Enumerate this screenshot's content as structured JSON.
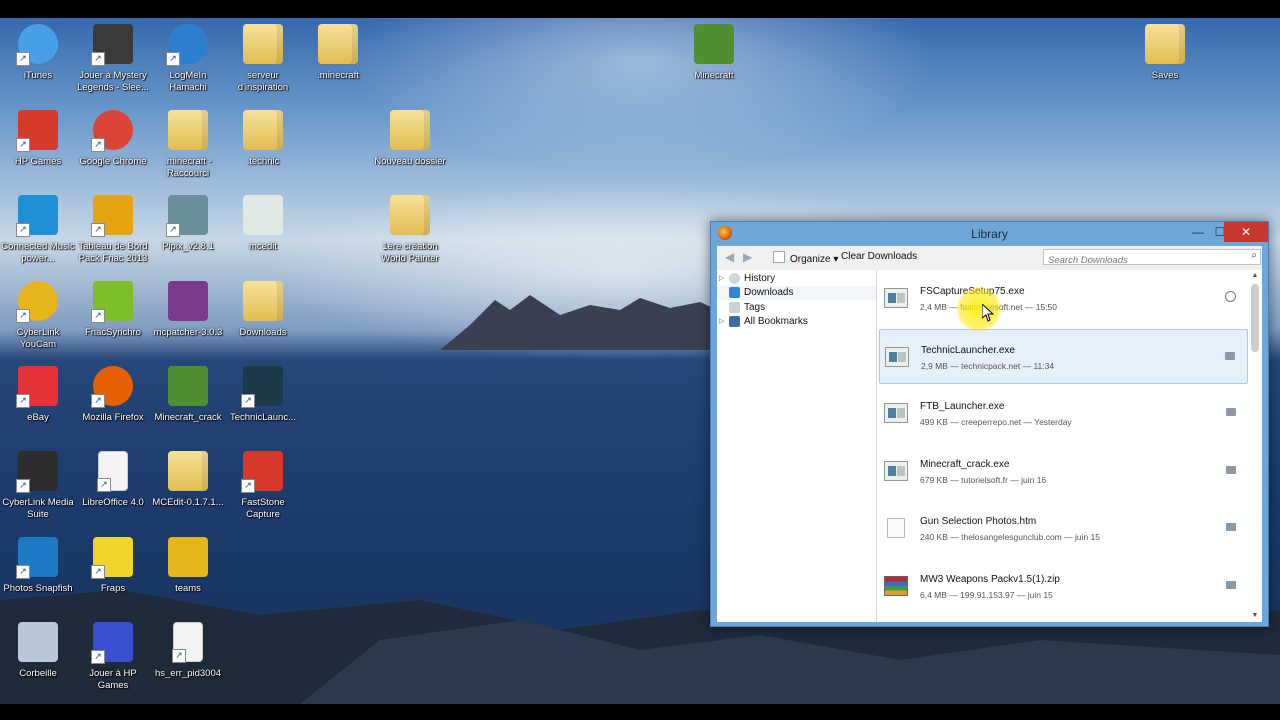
{
  "desktop": {
    "icons": [
      {
        "label": "iTunes",
        "icon": "itunes-icon",
        "color": "#4aa0e6"
      },
      {
        "label": "Jouer à Mystery Legends - Slee...",
        "icon": "game-icon",
        "color": "#3a3a3a"
      },
      {
        "label": "LogMeIn Hamachi",
        "icon": "hamachi-icon",
        "color": "#2f7fd0"
      },
      {
        "label": "serveur d'inspiration",
        "icon": "folder-icon",
        "color": "#e8c55a"
      },
      {
        "label": ".minecraft",
        "icon": "folder-icon",
        "color": "#e8c55a"
      },
      {
        "label": "Minecraft",
        "icon": "minecraft-grass-icon",
        "color": "#4f8f32"
      },
      {
        "label": "Saves",
        "icon": "folder-icon",
        "color": "#e8c55a"
      },
      {
        "label": "HP Games",
        "icon": "hp-games-icon",
        "color": "#d63a2a"
      },
      {
        "label": "Google Chrome",
        "icon": "chrome-icon",
        "color": "#db4437"
      },
      {
        "label": ".minecraft - Raccourci",
        "icon": "folder-icon",
        "color": "#e8c55a"
      },
      {
        "label": ".technic",
        "icon": "folder-icon",
        "color": "#e8c55a"
      },
      {
        "label": "Nouveau dossier",
        "icon": "folder-icon",
        "color": "#e8c55a"
      },
      {
        "label": "Connected Music power...",
        "icon": "equalizer-icon",
        "color": "#1f8fd6"
      },
      {
        "label": "Tableau de Bord Pack Fnac 2013",
        "icon": "fnac-icon",
        "color": "#e5a512"
      },
      {
        "label": "Pipix_v2.8.1",
        "icon": "minecraft-character-icon",
        "color": "#6b8f9a"
      },
      {
        "label": "mcedit",
        "icon": "mcedit-icon",
        "color": "#dfe8e2"
      },
      {
        "label": "1ère création World Painter",
        "icon": "folder-icon",
        "color": "#e8c55a"
      },
      {
        "label": "CyberLink YouCam",
        "icon": "webcam-icon",
        "color": "#e6b41c"
      },
      {
        "label": "FnacSynchro",
        "icon": "sync-icon",
        "color": "#7cbf2a"
      },
      {
        "label": "mcpatcher-3.0.3",
        "icon": "winrar-icon",
        "color": "#7a3a8c"
      },
      {
        "label": "Downloads",
        "icon": "downloads-folder-icon",
        "color": "#e8c55a"
      },
      {
        "label": "eBay",
        "icon": "ebay-icon",
        "color": "#e53238"
      },
      {
        "label": "Mozilla Firefox",
        "icon": "firefox-icon",
        "color": "#e66000"
      },
      {
        "label": "Minecraft_crack",
        "icon": "minecraft-grass-icon",
        "color": "#4f8f32"
      },
      {
        "label": "TechnicLaunc...",
        "icon": "technic-icon",
        "color": "#1c3a4a"
      },
      {
        "label": "CyberLink Media Suite",
        "icon": "media-suite-icon",
        "color": "#2d2d2d"
      },
      {
        "label": "LibreOffice 4.0",
        "icon": "document-icon",
        "color": "#f4f4f4"
      },
      {
        "label": "MCEdit-0.1.7.1...",
        "icon": "folder-icon",
        "color": "#e8c55a"
      },
      {
        "label": "FastStone Capture",
        "icon": "faststone-icon",
        "color": "#d8382a"
      },
      {
        "label": "Photos Snapfish",
        "icon": "snapfish-icon",
        "color": "#1d78c8"
      },
      {
        "label": "Fraps",
        "icon": "fraps-icon",
        "color": "#f0d52a"
      },
      {
        "label": "teams",
        "icon": "teams-icon",
        "color": "#e6b41c"
      },
      {
        "label": "Corbeille",
        "icon": "recycle-bin-icon",
        "color": "#b8c8d8"
      },
      {
        "label": "Jouer à HP Games",
        "icon": "hp-games-play-icon",
        "color": "#3a4fcf"
      },
      {
        "label": "hs_err_pid3004",
        "icon": "document-icon",
        "color": "#f4f4f4"
      }
    ]
  },
  "library": {
    "title": "Library",
    "toolbar": {
      "organize": "Organize",
      "clear": "Clear Downloads",
      "search_placeholder": "Search Downloads"
    },
    "sidebar": [
      {
        "label": "History",
        "icon": "history-icon"
      },
      {
        "label": "Downloads",
        "icon": "download-arrow-icon"
      },
      {
        "label": "Tags",
        "icon": "tag-icon"
      },
      {
        "label": "All Bookmarks",
        "icon": "bookmarks-icon"
      }
    ],
    "downloads": [
      {
        "name": "FSCaptureSetup75.exe",
        "meta": "2,4 MB — faststonesoft.net — 15:50",
        "type": "exe"
      },
      {
        "name": "TechnicLauncher.exe",
        "meta": "2,9 MB — technicpack.net — 11:34",
        "type": "exe"
      },
      {
        "name": "FTB_Launcher.exe",
        "meta": "499 KB — creeperrepo.net — Yesterday",
        "type": "exe"
      },
      {
        "name": "Minecraft_crack.exe",
        "meta": "679 KB — tutorielsoft.fr — juin 16",
        "type": "exe"
      },
      {
        "name": "Gun Selection Photos.htm",
        "meta": "240 KB — thelosangelesgunclub.com — juin 15",
        "type": "htm"
      },
      {
        "name": "MW3 Weapons Packv1.5(1).zip",
        "meta": "6,4 MB — 199.91.153.97 — juin 15",
        "type": "zip"
      }
    ]
  }
}
